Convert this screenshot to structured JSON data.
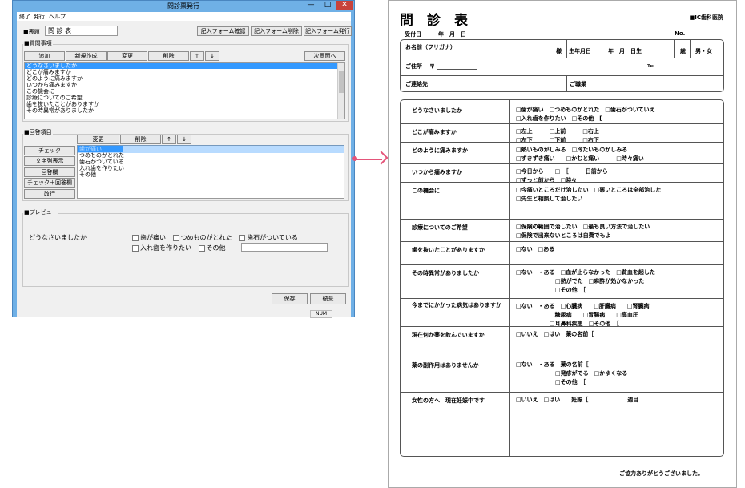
{
  "window": {
    "title": "問診票発行",
    "min_glyph": "—",
    "max_glyph": "□",
    "close_glyph": "✕",
    "menu": [
      "終了",
      "発行",
      "ヘルプ"
    ],
    "form_title_label": "■表題",
    "form_title_value": "問 診 表",
    "top_buttons": [
      "記入フォーム確認",
      "記入フォーム削除",
      "記入フォーム発行"
    ],
    "questions_group": "■質問事項",
    "q_toolbar": [
      "追加",
      "新規作成",
      "変更",
      "削除",
      "↑",
      "↓"
    ],
    "next_page": "次画面へ",
    "questions": [
      "どうなさいましたか",
      "どこが痛みますか",
      "どのように痛みますか",
      "いつから痛みますか",
      "この機会に",
      "診療についてのご希望",
      "歯を抜いたことがありますか",
      "その時異常がありましたか"
    ],
    "answers_group": "■回答項目",
    "a_toolbar": [
      "変更",
      "削除",
      "↑",
      "↓"
    ],
    "answer_types": [
      "チェック",
      "文字列表示",
      "回答欄",
      "チェック＋回答欄",
      "改行"
    ],
    "answers": [
      "歯が痛い",
      "つめものがとれた",
      "歯石がついている",
      "入れ歯を作りたい",
      "その他"
    ],
    "preview_group": "■プレビュー",
    "preview_question": "どうなさいましたか",
    "preview_options": [
      "歯が痛い",
      "つめものがとれた",
      "歯石がついている",
      "入れ歯を作りたい",
      "その他"
    ],
    "save": "保存",
    "discard": "破棄",
    "status_num": "NUM"
  },
  "doc": {
    "title": "問　診　表",
    "clinic": "■IC歯科医院",
    "reception_date": "受付日　　　年　月　日",
    "number": "No.",
    "name_label": "お名前（フリガナ）",
    "sama": "様",
    "birth": "生年月日　　　年　月　日生",
    "age": "歳",
    "sex": "男・女",
    "address_label": "ご住所",
    "postal_mark": "〒",
    "tel": "℡",
    "contact_label": "ご連絡先",
    "job_label": "ご職業",
    "rows": [
      {
        "q": "どうなさいましたか",
        "a": [
          "□歯が痛い　□つめものがとれた　□歯石がついていえ",
          "□入れ歯を作りたい　□その他　["
        ]
      },
      {
        "q": "どこが痛みますか",
        "a": [
          "□左上　　　□上前　　　□右上",
          "□左下　　　□下前　　　□右下"
        ]
      },
      {
        "q": "どのように痛みますか",
        "a": [
          "□熱いものがしみる　□冷たいものがしみる",
          "□ずきずき痛い　　□かむと痛い　　　□時々痛い"
        ]
      },
      {
        "q": "いつから痛みますか",
        "a": [
          "□今日から　　□　［　　　日前から",
          "□ずっと前から　□時々"
        ]
      },
      {
        "q": "この機会に",
        "a": [
          "□今痛いところだけ治したい　□悪いところは全部治した",
          "□先生と相談して治したい"
        ]
      },
      {
        "q": "診療についてのご希望",
        "a": [
          "□保険の範囲で治したい　□最も良い方法で治したい",
          "□保険で出来ないところは自費でもよ"
        ]
      },
      {
        "q": "歯を抜いたことがありますか",
        "a": [
          "□ない　□ある"
        ]
      },
      {
        "q": "その時異常がありましたか",
        "a": [
          "□ない　・ある　□血が止らなかった　□貧血を起した",
          "　　　　　　　□熱がでた　□麻酔が効かなかった",
          "　　　　　　　□その他　［"
        ]
      },
      {
        "q": "今までにかかった病気はありますか",
        "a": [
          "□ない　・ある　□心臓病　　□肝臓病　　□腎臓病",
          "　　　　　　□糖尿病　　□胃腸病　　□高血圧",
          "　　　　　　□耳鼻科疾患　□その他　［"
        ]
      },
      {
        "q": "現在何か薬を飲んでいますか",
        "a": [
          "□いいえ　□はい　薬の名前［"
        ]
      },
      {
        "q": "薬の副作用はありませんか",
        "a": [
          "□ない　・ある　薬の名前［",
          "　　　　　　　□発疹がでる　□かゆくなる",
          "　　　　　　　□その他　［"
        ]
      },
      {
        "q": "女性の方へ　現在妊娠中です",
        "a": [
          "□いいえ　□はい　　妊娠［　　　　　　　週目"
        ]
      }
    ],
    "footer": "ご協力ありがとうございました。"
  }
}
